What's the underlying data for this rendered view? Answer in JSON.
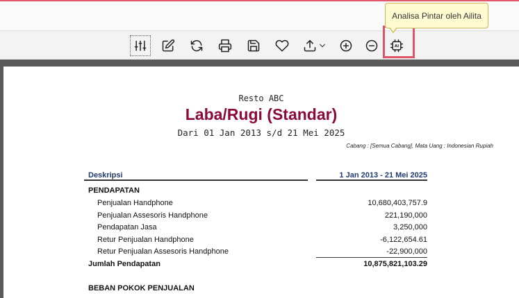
{
  "tooltip": {
    "text": "Analisa Pintar oleh Ailita"
  },
  "toolbar": {
    "buttons": [
      {
        "name": "filter-settings",
        "icon": "sliders-icon"
      },
      {
        "name": "edit",
        "icon": "edit-icon"
      },
      {
        "name": "refresh",
        "icon": "refresh-icon"
      },
      {
        "name": "print",
        "icon": "printer-icon"
      },
      {
        "name": "save",
        "icon": "save-icon"
      },
      {
        "name": "favorite",
        "icon": "heart-icon"
      },
      {
        "name": "export",
        "icon": "upload-icon"
      },
      {
        "name": "zoom-in",
        "icon": "plus-circle-icon"
      },
      {
        "name": "zoom-out",
        "icon": "minus-circle-icon"
      },
      {
        "name": "ai-analysis",
        "icon": "ai-chip-icon",
        "label": "AI"
      }
    ]
  },
  "report": {
    "company": "Resto ABC",
    "title": "Laba/Rugi (Standar)",
    "period": "Dari 01 Jan 2013 s/d 21 Mei 2025",
    "meta": "Cabang : [Semua Cabang], Mata Uang : Indonesian Rupiah",
    "col_desc": "Deskripsi",
    "col_period": "1 Jan 2013 - 21 Mei 2025",
    "rows": [
      {
        "type": "section",
        "label": "PENDAPATAN",
        "value": ""
      },
      {
        "type": "item",
        "label": "Penjualan Handphone",
        "value": "10,680,403,757.9"
      },
      {
        "type": "item",
        "label": "Penjualan Assesoris Handphone",
        "value": "221,190,000"
      },
      {
        "type": "item",
        "label": "Pendapatan Jasa",
        "value": "3,250,000"
      },
      {
        "type": "item",
        "label": "Retur Penjualan Handphone",
        "value": "-6,122,654.61"
      },
      {
        "type": "item",
        "label": "Retur Penjualan Assesoris Handphone",
        "value": "-22,900,000"
      },
      {
        "type": "total",
        "label": "Jumlah Pendapatan",
        "value": "10,875,821,103.29"
      },
      {
        "type": "section",
        "label": "BEBAN POKOK PENJUALAN",
        "value": ""
      }
    ]
  }
}
